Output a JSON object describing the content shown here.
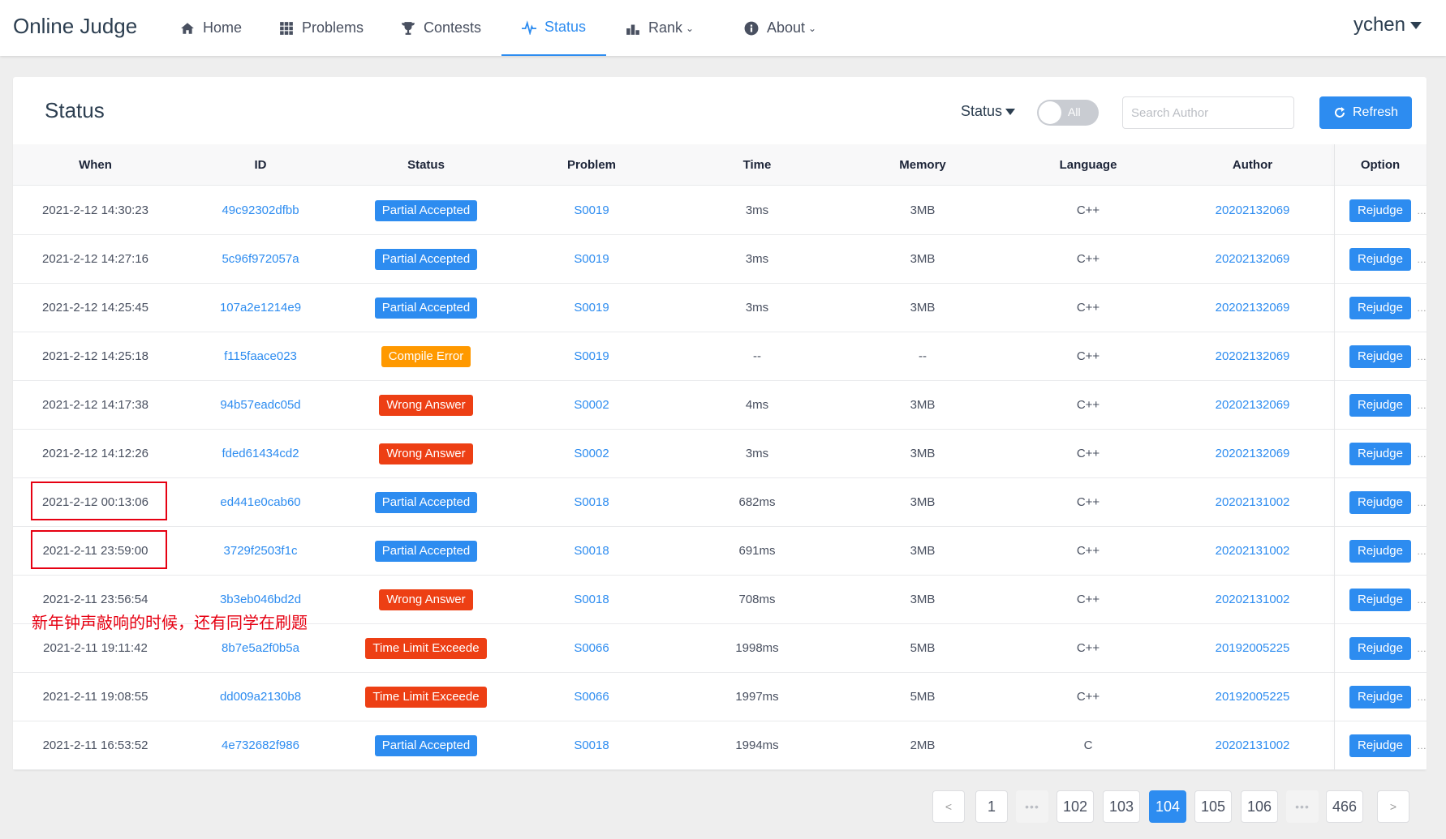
{
  "header": {
    "logo": "Online Judge",
    "nav": [
      {
        "label": "Home",
        "icon": "home-icon"
      },
      {
        "label": "Problems",
        "icon": "grid-icon"
      },
      {
        "label": "Contests",
        "icon": "trophy-icon"
      },
      {
        "label": "Status",
        "icon": "pulse-icon",
        "active": true
      },
      {
        "label": "Rank",
        "icon": "bar-chart-icon",
        "dropdown": true
      },
      {
        "label": "About",
        "icon": "info-icon",
        "dropdown": true
      }
    ],
    "user": "ychen"
  },
  "panel": {
    "title": "Status",
    "status_filter": "Status",
    "toggle_label": "All",
    "search_placeholder": "Search Author",
    "refresh_label": "Refresh"
  },
  "table": {
    "columns": [
      "When",
      "ID",
      "Status",
      "Problem",
      "Time",
      "Memory",
      "Language",
      "Author",
      "Option"
    ],
    "rows": [
      {
        "when": "2021-2-12 14:30:23",
        "id": "49c92302dfbb",
        "status": "Partial Accepted",
        "status_type": "blue",
        "problem": "S0019",
        "time": "3ms",
        "memory": "3MB",
        "language": "C++",
        "author": "20202132069",
        "option": "Rejudge"
      },
      {
        "when": "2021-2-12 14:27:16",
        "id": "5c96f972057a",
        "status": "Partial Accepted",
        "status_type": "blue",
        "problem": "S0019",
        "time": "3ms",
        "memory": "3MB",
        "language": "C++",
        "author": "20202132069",
        "option": "Rejudge"
      },
      {
        "when": "2021-2-12 14:25:45",
        "id": "107a2e1214e9",
        "status": "Partial Accepted",
        "status_type": "blue",
        "problem": "S0019",
        "time": "3ms",
        "memory": "3MB",
        "language": "C++",
        "author": "20202132069",
        "option": "Rejudge"
      },
      {
        "when": "2021-2-12 14:25:18",
        "id": "f115faace023",
        "status": "Compile Error",
        "status_type": "orange",
        "problem": "S0019",
        "time": "--",
        "memory": "--",
        "language": "C++",
        "author": "20202132069",
        "option": "Rejudge"
      },
      {
        "when": "2021-2-12 14:17:38",
        "id": "94b57eadc05d",
        "status": "Wrong Answer",
        "status_type": "red",
        "problem": "S0002",
        "time": "4ms",
        "memory": "3MB",
        "language": "C++",
        "author": "20202132069",
        "option": "Rejudge"
      },
      {
        "when": "2021-2-12 14:12:26",
        "id": "fded61434cd2",
        "status": "Wrong Answer",
        "status_type": "red",
        "problem": "S0002",
        "time": "3ms",
        "memory": "3MB",
        "language": "C++",
        "author": "20202132069",
        "option": "Rejudge"
      },
      {
        "when": "2021-2-12 00:13:06",
        "id": "ed441e0cab60",
        "status": "Partial Accepted",
        "status_type": "blue",
        "problem": "S0018",
        "time": "682ms",
        "memory": "3MB",
        "language": "C++",
        "author": "20202131002",
        "option": "Rejudge"
      },
      {
        "when": "2021-2-11 23:59:00",
        "id": "3729f2503f1c",
        "status": "Partial Accepted",
        "status_type": "blue",
        "problem": "S0018",
        "time": "691ms",
        "memory": "3MB",
        "language": "C++",
        "author": "20202131002",
        "option": "Rejudge"
      },
      {
        "when": "2021-2-11 23:56:54",
        "id": "3b3eb046bd2d",
        "status": "Wrong Answer",
        "status_type": "red",
        "problem": "S0018",
        "time": "708ms",
        "memory": "3MB",
        "language": "C++",
        "author": "20202131002",
        "option": "Rejudge"
      },
      {
        "when": "2021-2-11 19:11:42",
        "id": "8b7e5a2f0b5a",
        "status": "Time Limit Exceede",
        "status_type": "red",
        "problem": "S0066",
        "time": "1998ms",
        "memory": "5MB",
        "language": "C++",
        "author": "20192005225",
        "option": "Rejudge"
      },
      {
        "when": "2021-2-11 19:08:55",
        "id": "dd009a2130b8",
        "status": "Time Limit Exceede",
        "status_type": "red",
        "problem": "S0066",
        "time": "1997ms",
        "memory": "5MB",
        "language": "C++",
        "author": "20192005225",
        "option": "Rejudge"
      },
      {
        "when": "2021-2-11 16:53:52",
        "id": "4e732682f986",
        "status": "Partial Accepted",
        "status_type": "blue",
        "problem": "S0018",
        "time": "1994ms",
        "memory": "2MB",
        "language": "C",
        "author": "20202131002",
        "option": "Rejudge"
      }
    ]
  },
  "annotation": "新年钟声敲响的时候，还有同学在刷题",
  "pagination": {
    "prev": "<",
    "next": ">",
    "items": [
      "1",
      "•••",
      "102",
      "103",
      "104",
      "105",
      "106",
      "•••",
      "466"
    ],
    "current": "104"
  },
  "colors": {
    "accent": "#2d8cf0",
    "error": "#ed3f14",
    "warning": "#ff9900",
    "highlight": "#e60012"
  }
}
